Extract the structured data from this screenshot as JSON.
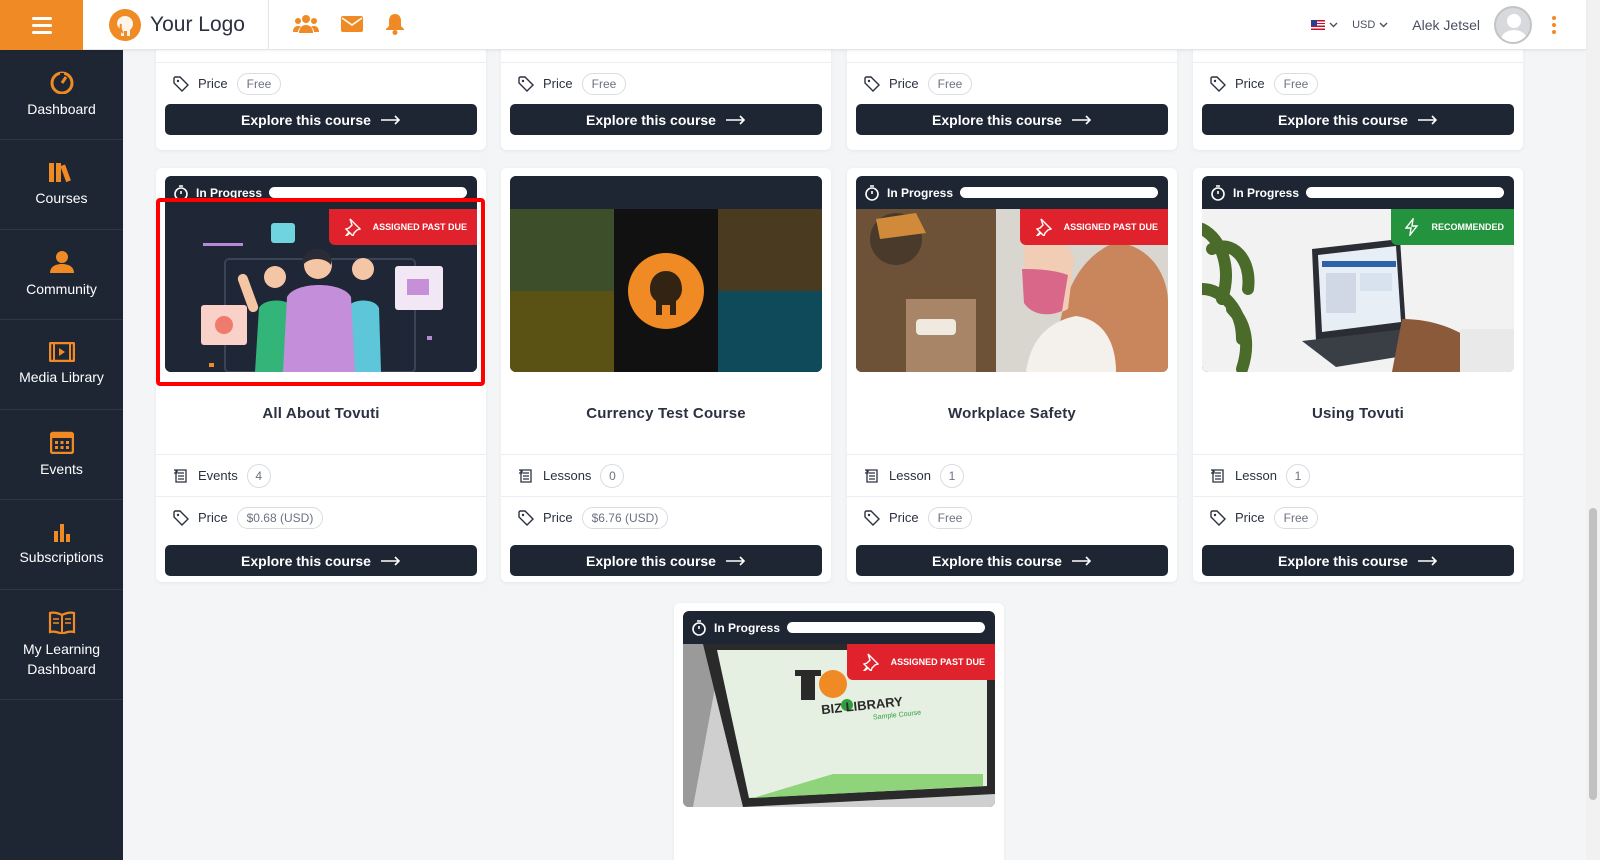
{
  "topbar": {
    "logo_text": "Your Logo",
    "currency": "USD",
    "user_name": "Alek Jetsel",
    "icons": [
      "menu-icon",
      "users-icon",
      "mail-icon",
      "bell-icon",
      "flag-icon",
      "avatar",
      "kebab-icon"
    ],
    "accent_color": "#f08a24"
  },
  "sidebar": {
    "items": [
      {
        "label": "Dashboard",
        "icon": "speedometer-icon"
      },
      {
        "label": "Courses",
        "icon": "books-icon"
      },
      {
        "label": "Community",
        "icon": "community-icon"
      },
      {
        "label": "Media Library",
        "icon": "film-icon"
      },
      {
        "label": "Events",
        "icon": "calendar-icon"
      },
      {
        "label": "Subscriptions",
        "icon": "bar-chart-icon"
      },
      {
        "label": "My Learning Dashboard",
        "icon": "open-book-icon"
      }
    ]
  },
  "common": {
    "explore_label": "Explore this course",
    "price_label": "Price",
    "in_progress_label": "In Progress"
  },
  "top_row": [
    {
      "price": "Free"
    },
    {
      "price": "Free"
    },
    {
      "price": "Free"
    },
    {
      "price": "Free"
    }
  ],
  "courses": [
    {
      "title": "All About Tovuti",
      "status": "In Progress",
      "badge": "ASSIGNED PAST DUE",
      "badge_type": "red",
      "meta_label": "Events",
      "meta_count": "4",
      "price": "$0.68 (USD)"
    },
    {
      "title": "Currency Test Course",
      "status": "",
      "badge": "",
      "badge_type": "",
      "meta_label": "Lessons",
      "meta_count": "0",
      "price": "$6.76 (USD)"
    },
    {
      "title": "Workplace Safety",
      "status": "In Progress",
      "badge": "ASSIGNED PAST DUE",
      "badge_type": "red",
      "meta_label": "Lesson",
      "meta_count": "1",
      "price": "Free"
    },
    {
      "title": "Using Tovuti",
      "status": "In Progress",
      "badge": "RECOMMENDED",
      "badge_type": "green",
      "meta_label": "Lesson",
      "meta_count": "1",
      "price": "Free"
    }
  ],
  "bottom_course": {
    "status": "In Progress",
    "badge": "ASSIGNED PAST DUE",
    "image_text_brand": "BIZ LIBRARY",
    "image_text_sub": "Sample Course"
  },
  "colors": {
    "sidebar_bg": "#1e2533",
    "past_due": "#e0222c",
    "recommended": "#24933d"
  }
}
